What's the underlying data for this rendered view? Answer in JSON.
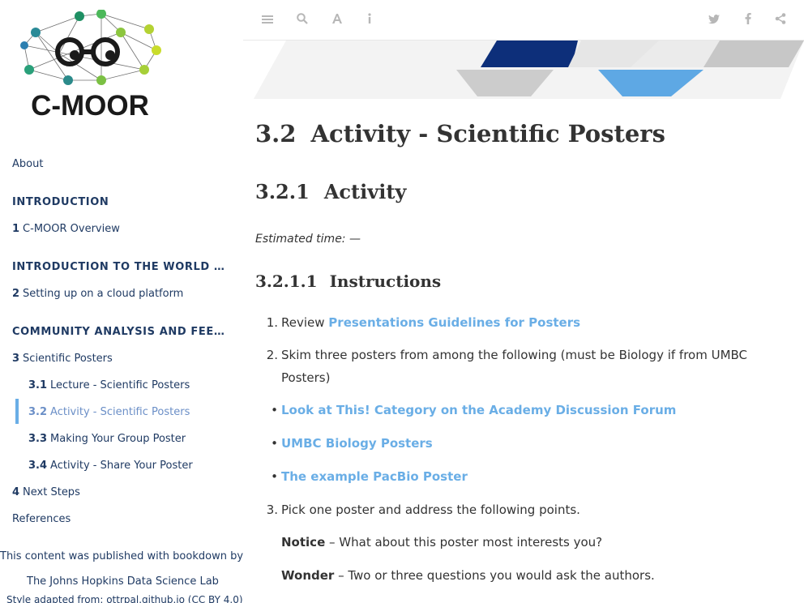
{
  "sidebar": {
    "logo_text": "C-MOOR",
    "items": [
      {
        "kind": "item",
        "num": "",
        "label": "About"
      },
      {
        "kind": "header",
        "label": "INTRODUCTION"
      },
      {
        "kind": "item",
        "num": "1",
        "label": "C-MOOR Overview"
      },
      {
        "kind": "header",
        "label": "INTRODUCTION TO THE WORLD OF RES…"
      },
      {
        "kind": "item",
        "num": "2",
        "label": "Setting up on a cloud platform"
      },
      {
        "kind": "header",
        "label": "COMMUNITY ANALYSIS AND FEEDBACK"
      },
      {
        "kind": "item",
        "num": "3",
        "label": "Scientific Posters"
      },
      {
        "kind": "sub",
        "num": "3.1",
        "label": "Lecture - Scientific Posters"
      },
      {
        "kind": "sub-active",
        "num": "3.2",
        "label": "Activity - Scientific Posters"
      },
      {
        "kind": "sub",
        "num": "3.3",
        "label": "Making Your Group Poster"
      },
      {
        "kind": "sub",
        "num": "3.4",
        "label": "Activity - Share Your Poster"
      },
      {
        "kind": "item",
        "num": "4",
        "label": "Next Steps"
      },
      {
        "kind": "item",
        "num": "",
        "label": "References"
      }
    ],
    "published_label": "This content was published with bookdown by:",
    "credit_label": "The Johns Hopkins Data Science Lab",
    "cutoff_label": "Style adapted from: ottrpal.github.io (CC BY 4.0)"
  },
  "toolbar": {
    "left_icons": [
      "list-icon",
      "search-icon",
      "font-icon",
      "info-icon"
    ],
    "right_icons": [
      "twitter-icon",
      "facebook-icon",
      "share-icon"
    ]
  },
  "content": {
    "h1_num": "3.2",
    "h1_text": "Activity - Scientific Posters",
    "h2_num": "3.2.1",
    "h2_text": "Activity",
    "estimated_time": "Estimated time: —",
    "h3_num": "3.2.1.1",
    "h3_text": "Instructions",
    "list": {
      "i1_marker": "1.",
      "i1_prefix": "Review ",
      "i1_link": "Presentations Guidelines for Posters",
      "i2_marker": "2.",
      "i2_text": "Skim three posters from among the following (must be Biology if from UMBC Posters)",
      "b1_link": "Look at This! Category on the Academy Discussion Forum",
      "b2_link": "UMBC Biology Posters",
      "b3_link": "The example PacBio Poster",
      "i3_marker": "3.",
      "i3_text": "Pick one poster and address the following points.",
      "b4_bold": "Notice",
      "b4_rest": " – What about this poster most interests you?",
      "b5_bold": "Wonder",
      "b5_rest": " – Two or three questions you would ask the authors."
    }
  },
  "colors": {
    "nav_text": "#1f3a63",
    "link": "#6aaee6",
    "active_bar": "#6aaee6",
    "banner_dark": "#0d2f7a",
    "banner_light": "#5ea8e4"
  }
}
